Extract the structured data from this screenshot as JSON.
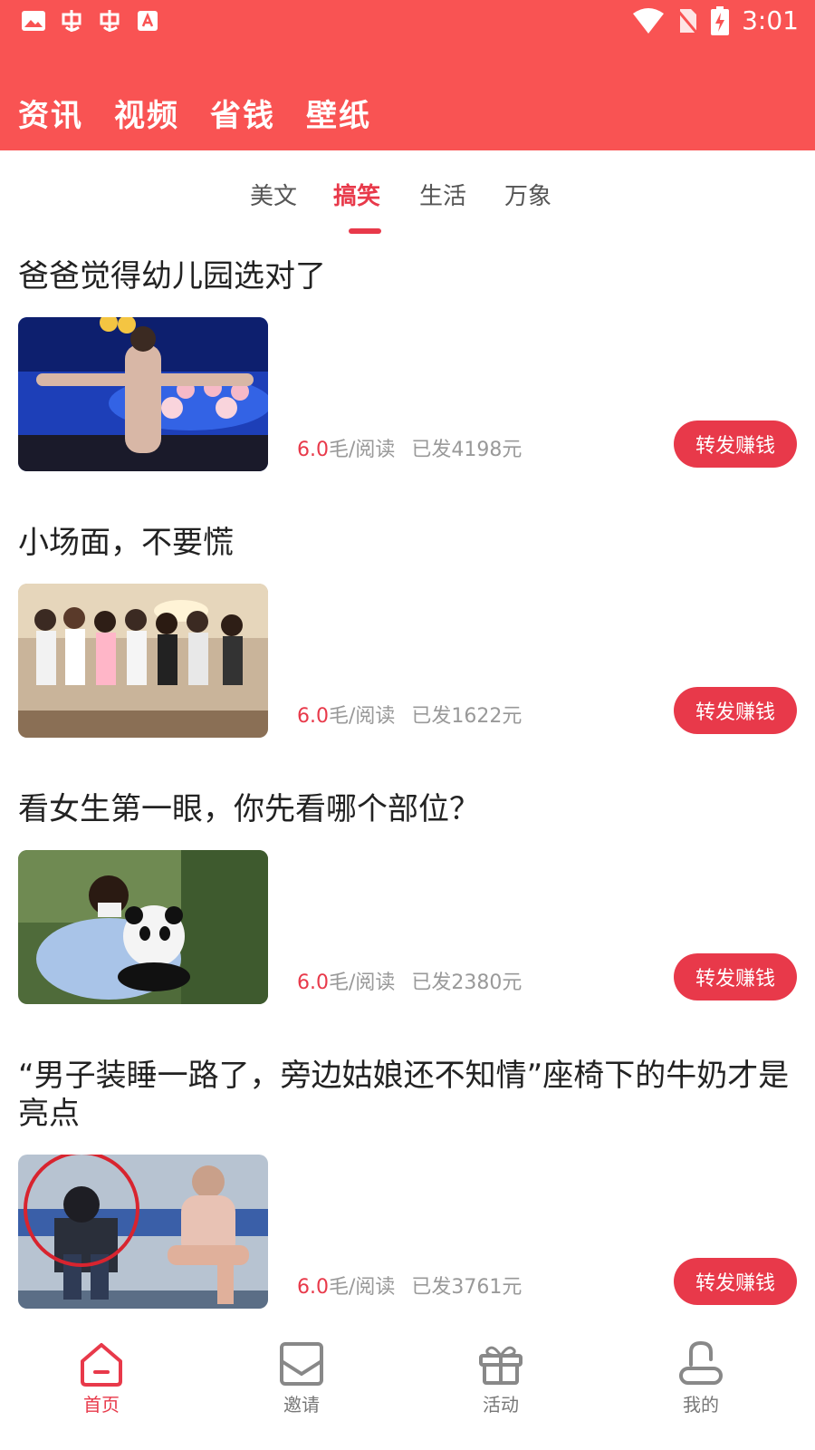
{
  "status_bar": {
    "time": "3:01"
  },
  "top_nav": {
    "tabs": [
      "资讯",
      "视频",
      "省钱",
      "壁纸"
    ]
  },
  "sub_tabs": {
    "items": [
      "美文",
      "搞笑",
      "生活",
      "万象"
    ],
    "active": "搞笑"
  },
  "articles": [
    {
      "title": "爸爸觉得幼儿园选对了",
      "rate_value": "6.0",
      "rate_unit": "毛/阅读",
      "sent": "已发4198元",
      "button": "转发赚钱"
    },
    {
      "title": "小场面，不要慌",
      "rate_value": "6.0",
      "rate_unit": "毛/阅读",
      "sent": "已发1622元",
      "button": "转发赚钱"
    },
    {
      "title": "看女生第一眼，你先看哪个部位？",
      "rate_value": "6.0",
      "rate_unit": "毛/阅读",
      "sent": "已发2380元",
      "button": "转发赚钱"
    },
    {
      "title": "“男子装睡一路了，旁边姑娘还不知情”座椅下的牛奶才是亮点",
      "rate_value": "6.0",
      "rate_unit": "毛/阅读",
      "sent": "已发3761元",
      "button": "转发赚钱"
    }
  ],
  "bottom_nav": {
    "items": [
      {
        "label": "首页",
        "icon": "home-icon",
        "active": true
      },
      {
        "label": "邀请",
        "icon": "envelope-icon",
        "active": false
      },
      {
        "label": "活动",
        "icon": "gift-icon",
        "active": false
      },
      {
        "label": "我的",
        "icon": "profile-icon",
        "active": false
      }
    ]
  },
  "colors": {
    "header": "#f95353",
    "accent": "#e8394a"
  }
}
